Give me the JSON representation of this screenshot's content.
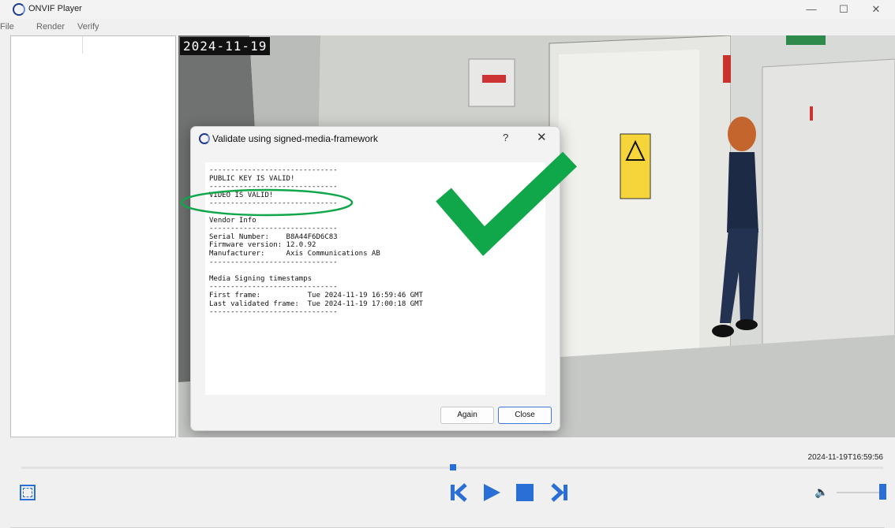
{
  "window": {
    "title": "ONVIF Player",
    "minimize": "—",
    "maximize": "☐",
    "close": "✕"
  },
  "menu": [
    "File",
    "Render",
    "Verify"
  ],
  "video": {
    "overlay_timestamp": "2024-11-19"
  },
  "dialog": {
    "title": "Validate using signed-media-framework",
    "help": "?",
    "close": "✕",
    "report": "------------------------------\nPUBLIC KEY IS VALID!\n------------------------------\nVIDEO IS VALID!\n------------------------------\n\nVendor Info\n------------------------------\nSerial Number:    B8A44F6D6C83\nFirmware version: 12.0.92\nManufacturer:     Axis Communications AB\n------------------------------\n\nMedia Signing timestamps\n------------------------------\nFirst frame:           Tue 2024-11-19 16:59:46 GMT\nLast validated frame:  Tue 2024-11-19 17:00:18 GMT\n------------------------------",
    "buttons": {
      "again": "Again",
      "close": "Close"
    }
  },
  "playback": {
    "time_label": "2024-11-19T16:59:56",
    "progress_fraction": 0.5,
    "volume_fraction": 1.0
  },
  "colors": {
    "accent": "#2a6fd6",
    "valid_check": "#10a64a"
  },
  "icons": [
    "app-logo-icon",
    "fullscreen-icon",
    "skip-back-icon",
    "play-icon",
    "stop-icon",
    "skip-forward-icon",
    "volume-icon",
    "checkmark-icon"
  ]
}
